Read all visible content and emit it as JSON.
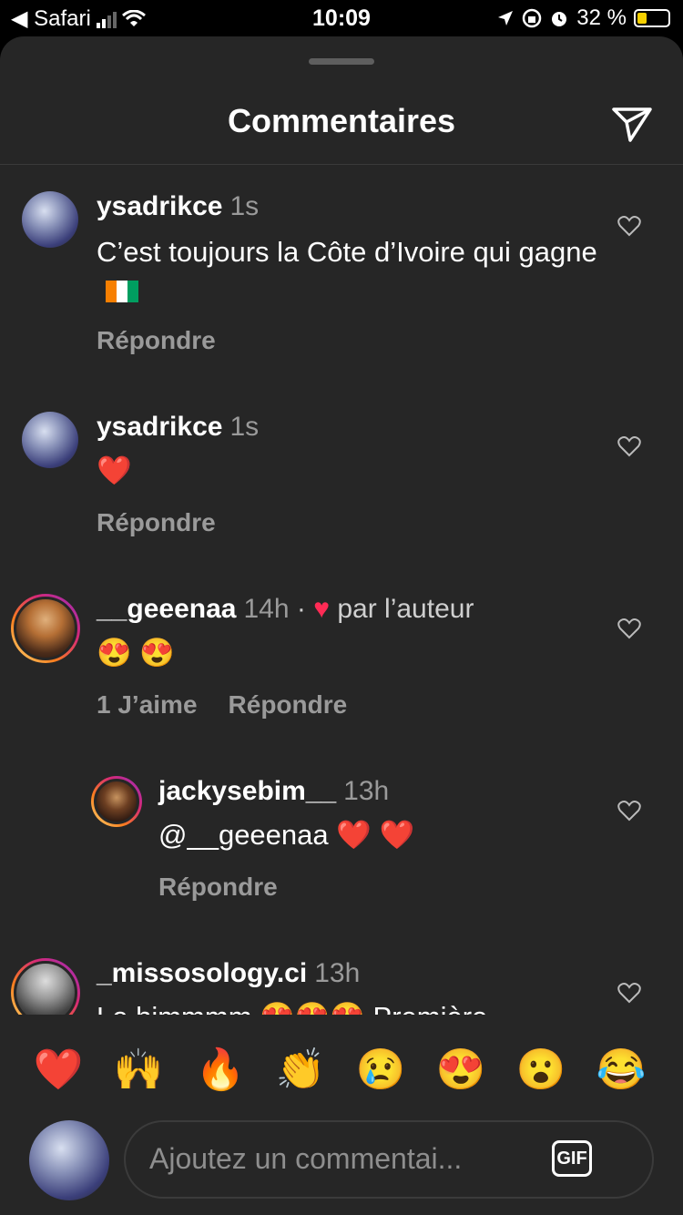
{
  "status_bar": {
    "back_label": "◀ Safari",
    "time": "10:09",
    "battery": "32 %"
  },
  "header": {
    "title": "Commentaires"
  },
  "comments": [
    {
      "username": "ysadrikce",
      "time": "1s",
      "text": "C’est toujours la Côte d’Ivoire qui gagne",
      "actions": [
        "Répondre"
      ]
    },
    {
      "username": "ysadrikce",
      "time": "1s",
      "text": "❤️",
      "actions": [
        "Répondre"
      ]
    },
    {
      "username": "__geeenaa",
      "time": "14h",
      "author_like": "par l’auteur",
      "text": "😍 😍",
      "actions": [
        "1 J’aime",
        "Répondre"
      ]
    },
    {
      "username": "jackysebim__",
      "time": "13h",
      "text": "@__geeenaa ❤️ ❤️",
      "actions": [
        "Répondre"
      ]
    },
    {
      "username": "_missosology.ci",
      "time": "13h",
      "text": "Le himmmm 😍😍😍 Première"
    }
  ],
  "reactions": [
    "❤️",
    "🙌",
    "🔥",
    "👏",
    "😢",
    "😍",
    "😮",
    "😂"
  ],
  "composer": {
    "placeholder": "Ajoutez un commentai...",
    "gif_label": "GIF"
  }
}
